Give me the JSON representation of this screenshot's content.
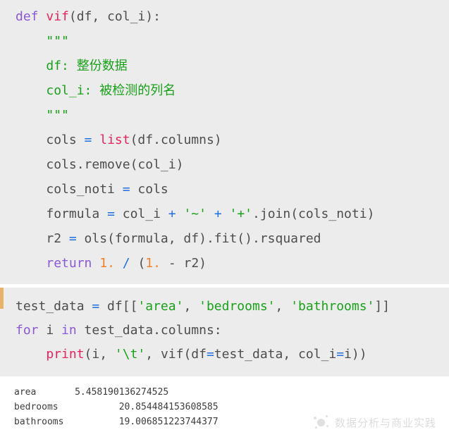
{
  "theme": {
    "page_background": "#ffffff",
    "code_background": "#ececec",
    "accent_bar_color": "#e8b26b",
    "keyword_color": "#8a59d6",
    "function_color": "#e8245f",
    "string_color": "#1aa11a",
    "operator_color": "#1f6fe0",
    "number_color": "#f5802a",
    "plain_color": "#4d4d4d",
    "output_text_color": "#3c3c3c"
  },
  "code_block_1": {
    "name": "vif-function-definition",
    "lines": [
      {
        "id": "l1",
        "indent": 0,
        "tokens": [
          {
            "t": "def",
            "c": "kw"
          },
          {
            "t": " ",
            "c": "plain"
          },
          {
            "t": "vif",
            "c": "fn"
          },
          {
            "t": "(df, col_i):",
            "c": "plain"
          }
        ]
      },
      {
        "id": "l2",
        "indent": 1,
        "tokens": [
          {
            "t": "\"\"\"",
            "c": "str"
          }
        ]
      },
      {
        "id": "l3",
        "indent": 1,
        "tokens": [
          {
            "t": "df: 整份数据",
            "c": "cmt"
          }
        ]
      },
      {
        "id": "l4",
        "indent": 1,
        "tokens": [
          {
            "t": "col_i: 被检测的列名",
            "c": "cmt"
          }
        ]
      },
      {
        "id": "l5",
        "indent": 1,
        "tokens": [
          {
            "t": "\"\"\"",
            "c": "str"
          }
        ]
      },
      {
        "id": "l6",
        "indent": 1,
        "tokens": [
          {
            "t": "cols ",
            "c": "plain"
          },
          {
            "t": "=",
            "c": "op"
          },
          {
            "t": " ",
            "c": "plain"
          },
          {
            "t": "list",
            "c": "fn"
          },
          {
            "t": "(df.columns)",
            "c": "plain"
          }
        ]
      },
      {
        "id": "l7",
        "indent": 1,
        "tokens": [
          {
            "t": "cols.remove(col_i)",
            "c": "plain"
          }
        ]
      },
      {
        "id": "l8",
        "indent": 1,
        "tokens": [
          {
            "t": "cols_noti ",
            "c": "plain"
          },
          {
            "t": "=",
            "c": "op"
          },
          {
            "t": " cols",
            "c": "plain"
          }
        ]
      },
      {
        "id": "l9",
        "indent": 1,
        "tokens": [
          {
            "t": "formula ",
            "c": "plain"
          },
          {
            "t": "=",
            "c": "op"
          },
          {
            "t": " col_i ",
            "c": "plain"
          },
          {
            "t": "+",
            "c": "op"
          },
          {
            "t": " ",
            "c": "plain"
          },
          {
            "t": "'~'",
            "c": "str"
          },
          {
            "t": " ",
            "c": "plain"
          },
          {
            "t": "+",
            "c": "op"
          },
          {
            "t": " ",
            "c": "plain"
          },
          {
            "t": "'+'",
            "c": "str"
          },
          {
            "t": ".join(cols_noti)",
            "c": "plain"
          }
        ]
      },
      {
        "id": "l10",
        "indent": 1,
        "tokens": [
          {
            "t": "r2 ",
            "c": "plain"
          },
          {
            "t": "=",
            "c": "op"
          },
          {
            "t": " ols(formula, df).fit().rsquared",
            "c": "plain"
          }
        ]
      },
      {
        "id": "l11",
        "indent": 1,
        "tokens": [
          {
            "t": "return",
            "c": "kw"
          },
          {
            "t": " ",
            "c": "plain"
          },
          {
            "t": "1.",
            "c": "num"
          },
          {
            "t": " ",
            "c": "plain"
          },
          {
            "t": "/",
            "c": "op"
          },
          {
            "t": " (",
            "c": "plain"
          },
          {
            "t": "1.",
            "c": "num"
          },
          {
            "t": " - r2)",
            "c": "plain"
          }
        ]
      }
    ]
  },
  "code_block_2": {
    "name": "vif-usage-loop",
    "has_accent_bar": true,
    "lines": [
      {
        "id": "m1",
        "indent": 0,
        "tokens": [
          {
            "t": "test_data ",
            "c": "plain"
          },
          {
            "t": "=",
            "c": "op"
          },
          {
            "t": " df[[",
            "c": "plain"
          },
          {
            "t": "'area'",
            "c": "str"
          },
          {
            "t": ", ",
            "c": "plain"
          },
          {
            "t": "'bedrooms'",
            "c": "str"
          },
          {
            "t": ", ",
            "c": "plain"
          },
          {
            "t": "'bathrooms'",
            "c": "str"
          },
          {
            "t": "]]",
            "c": "plain"
          }
        ]
      },
      {
        "id": "m2",
        "indent": 0,
        "tokens": [
          {
            "t": "for",
            "c": "kw"
          },
          {
            "t": " i ",
            "c": "plain"
          },
          {
            "t": "in",
            "c": "kw"
          },
          {
            "t": " test_data.columns:",
            "c": "plain"
          }
        ]
      },
      {
        "id": "m3",
        "indent": 1,
        "tokens": [
          {
            "t": "print",
            "c": "fn"
          },
          {
            "t": "(i, ",
            "c": "plain"
          },
          {
            "t": "'\\t'",
            "c": "str"
          },
          {
            "t": ", vif(df",
            "c": "plain"
          },
          {
            "t": "=",
            "c": "op"
          },
          {
            "t": "test_data, col_i",
            "c": "plain"
          },
          {
            "t": "=",
            "c": "op"
          },
          {
            "t": "i))",
            "c": "plain"
          }
        ]
      }
    ]
  },
  "output": {
    "name": "console-output",
    "rows": [
      {
        "label": "area",
        "value": "5.458190136274525",
        "text": "area       5.458190136274525"
      },
      {
        "label": "bedrooms",
        "value": "20.854484153608585",
        "text": "bedrooms           20.854484153608585"
      },
      {
        "label": "bathrooms",
        "value": "19.006851223744377",
        "text": "bathrooms          19.006851223744377"
      }
    ]
  },
  "watermark": {
    "text": "数据分析与商业实践",
    "logo_name": "dotted-circle-logo"
  }
}
